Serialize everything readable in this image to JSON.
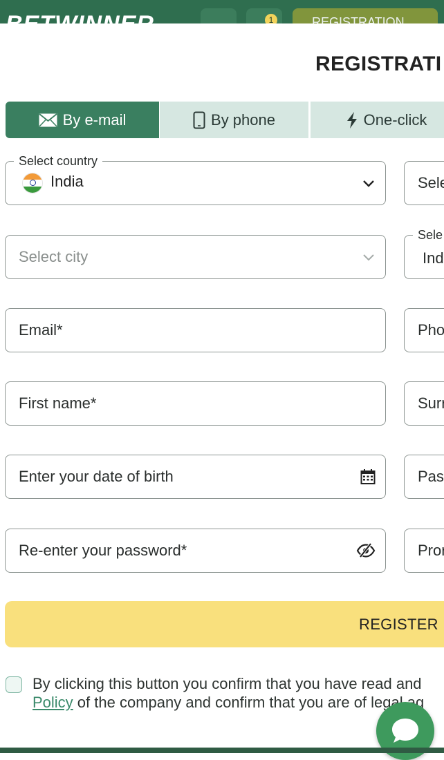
{
  "header": {
    "logo": "BETWINNER",
    "badge_count": "1",
    "registration_button": "REGISTRATION"
  },
  "modal": {
    "title": "REGISTRATI",
    "tabs": [
      {
        "label": "By e-mail",
        "icon": "envelope-icon",
        "active": true
      },
      {
        "label": "By phone",
        "icon": "phone-icon",
        "active": false
      },
      {
        "label": "One-click",
        "icon": "lightning-icon",
        "active": false
      }
    ]
  },
  "form": {
    "country": {
      "legend": "Select country",
      "value": "India"
    },
    "city": {
      "placeholder": "Select city"
    },
    "email": {
      "placeholder": "Email*"
    },
    "first_name": {
      "placeholder": "First name*"
    },
    "dob": {
      "placeholder": "Enter your date of birth"
    },
    "reenter_password": {
      "placeholder": "Re-enter your password*"
    },
    "right_column": {
      "r1": {
        "placeholder": "Sele"
      },
      "r2": {
        "legend": "Sele",
        "value": "Ind"
      },
      "r3": {
        "placeholder": "Pho"
      },
      "r4": {
        "placeholder": "Surr"
      },
      "r5": {
        "placeholder": "Pas"
      },
      "r6": {
        "placeholder": "Pror"
      }
    },
    "register_button": "REGISTER",
    "consent": {
      "line1": "By clicking this button you confirm that you have read and",
      "link": "Policy",
      "line2_rest": " of the company and confirm that you are of legal ag"
    }
  },
  "colors": {
    "accent_green": "#3a7f60",
    "tab_inactive": "#d6e7e1",
    "register_yellow": "#f9e07d",
    "chat_green": "#3e9a5d"
  }
}
